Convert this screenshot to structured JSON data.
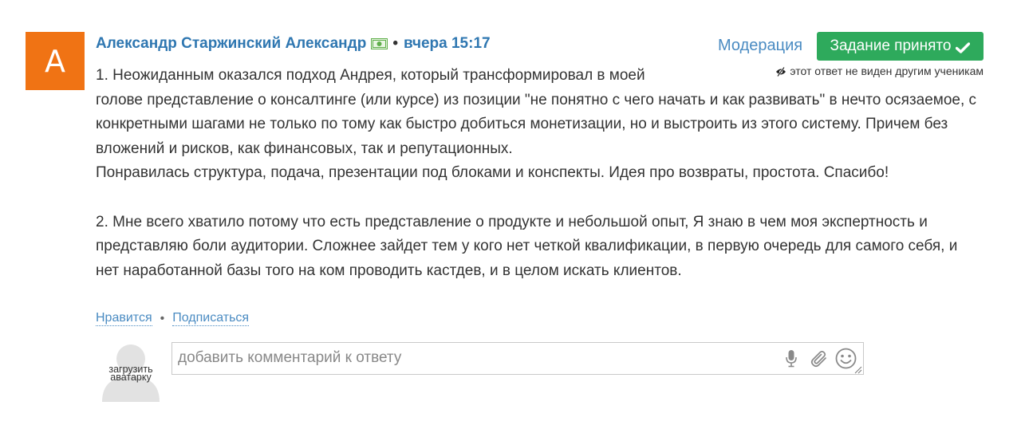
{
  "answer": {
    "author_initial": "А",
    "author_name": "Александр Старжинский Александр",
    "separator": "•",
    "time": "вчера 15:17",
    "moderation_label": "Модерация",
    "accepted_label": "Задание принято",
    "visibility_note": "этот ответ не виден другим ученикам",
    "paragraphs": [
      "1. Неожиданным оказался подход Андрея, который трансформировал в моей",
      "голове представление о консалтинге (или курсе) из позиции \"не понятно с чего начать и как развивать\" в нечто осязаемое, с конкретными шагами не только по тому как быстро добиться монетизации, но и выстроить из этого систему. Причем без вложений и рисков, как финансовых, так и репутационных.",
      "Понравилась структура, подача, презентации под блоками и конспекты. Идея про возвраты, простота. Спасибо!",
      "2. Мне всего хватило потому что есть представление о продукте и небольшой опыт, Я знаю в чем моя экспертность и представляю боли аудитории. Сложнее зайдет тем у кого нет четкой квалификации, в первую очередь для самого себя, и нет наработанной базы того на ком проводить кастдев, и в целом искать клиентов."
    ],
    "like_label": "Нравится",
    "action_separator": "•",
    "subscribe_label": "Подписаться"
  },
  "comment": {
    "avatar_caption_line1": "загрузить",
    "avatar_caption_line2": "аватарку",
    "placeholder": "добавить комментарий к ответу"
  },
  "colors": {
    "avatar_bg": "#f07314",
    "link": "#2f77b1",
    "accepted_bg": "#2eaa5c"
  },
  "icons": {
    "money": "money-icon",
    "check": "check-icon",
    "hidden": "eye-slash-icon",
    "mic": "microphone-icon",
    "attach": "paperclip-icon",
    "emoji": "smiley-icon"
  }
}
